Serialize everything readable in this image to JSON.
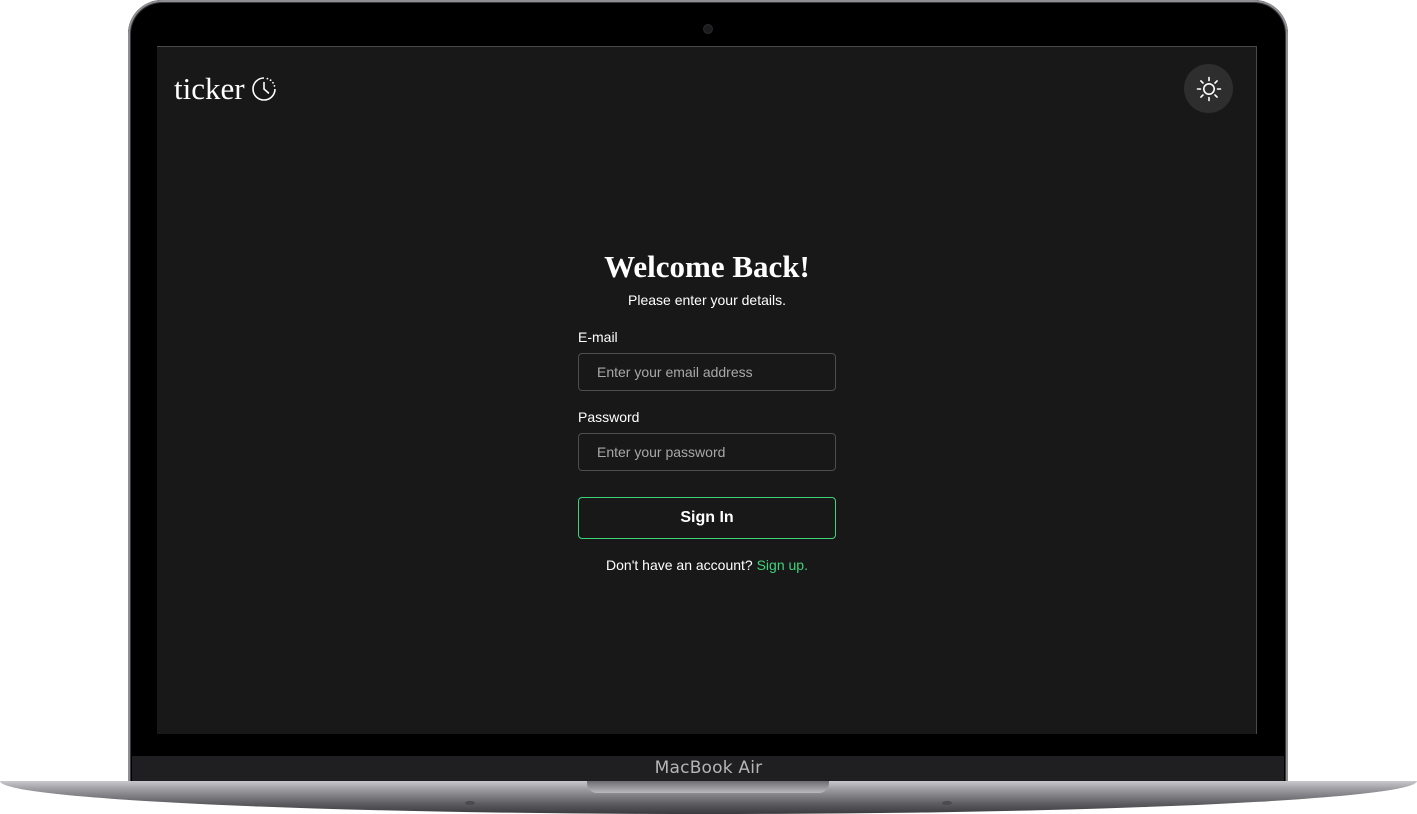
{
  "app": {
    "logo_text": "ticker",
    "logo_icon": "clock-icon",
    "theme_toggle_icon": "sun-icon"
  },
  "login": {
    "title": "Welcome Back!",
    "subtitle": "Please enter your details.",
    "email_label": "E-mail",
    "email_placeholder": "Enter your email address",
    "email_value": "",
    "password_label": "Password",
    "password_placeholder": "Enter your password",
    "password_value": "",
    "signin_label": "Sign In",
    "signup_prompt": "Don't have an account?",
    "signup_link": "Sign up."
  },
  "device": {
    "label": "MacBook Air"
  },
  "colors": {
    "background": "#181818",
    "accent": "#3fd37a",
    "text": "#ffffff",
    "input_border": "#4d4d4d",
    "toggle_bg": "#2e2e2e"
  }
}
